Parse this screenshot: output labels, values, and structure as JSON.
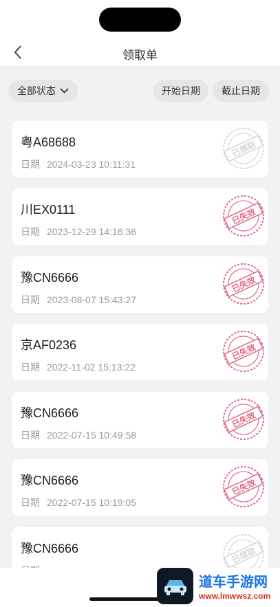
{
  "header": {
    "title": "领取单"
  },
  "filters": {
    "status_label": "全部状态",
    "start_date_label": "开始日期",
    "end_date_label": "截止日期"
  },
  "date_label": "日期",
  "records": [
    {
      "plate": "粤A68688",
      "datetime": "2024-03-23 10:11:31",
      "stamp": "已领取",
      "stamp_type": "claimed"
    },
    {
      "plate": "川EX0111",
      "datetime": "2023-12-29 14:16:36",
      "stamp": "已失效",
      "stamp_type": "expired"
    },
    {
      "plate": "豫CN6666",
      "datetime": "2023-08-07 15:43:27",
      "stamp": "已失效",
      "stamp_type": "expired"
    },
    {
      "plate": "京AF0236",
      "datetime": "2022-11-02 15:13:22",
      "stamp": "已失效",
      "stamp_type": "expired"
    },
    {
      "plate": "豫CN6666",
      "datetime": "2022-07-15 10:49:58",
      "stamp": "已失效",
      "stamp_type": "expired"
    },
    {
      "plate": "豫CN6666",
      "datetime": "2022-07-15 10:19:05",
      "stamp": "已失效",
      "stamp_type": "expired"
    },
    {
      "plate": "豫CN6666",
      "datetime": "",
      "stamp": "已领取",
      "stamp_type": "claimed"
    }
  ],
  "watermark": {
    "text": "道车手游网",
    "sub": "www.lmwwsz.com"
  },
  "colors": {
    "expired": "#e06a82",
    "claimed": "#d6d6d6"
  }
}
